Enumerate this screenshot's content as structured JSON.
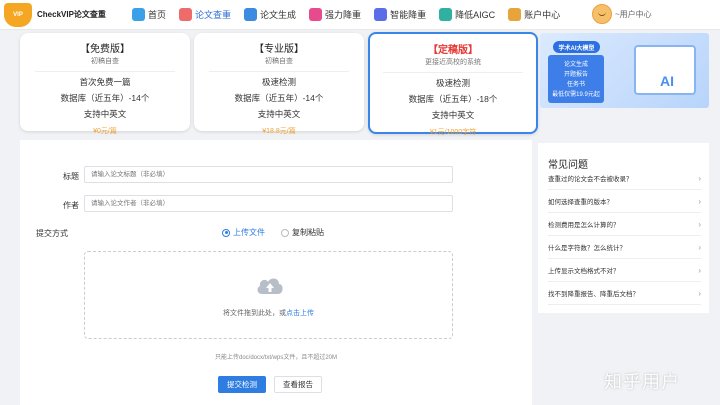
{
  "app": {
    "logo_badge": "VIP",
    "name": "CheckVIP论文查重"
  },
  "nav": [
    {
      "label": "首页",
      "color": "#3aa1e8"
    },
    {
      "label": "论文查重",
      "color": "#ee6b6b",
      "active": true
    },
    {
      "label": "论文生成",
      "color": "#3d8be0"
    },
    {
      "label": "强力降重",
      "color": "#e84a8e"
    },
    {
      "label": "智能降重",
      "color": "#5b6ee8"
    },
    {
      "label": "降低AIGC",
      "color": "#2fb0a0"
    },
    {
      "label": "账户中心",
      "color": "#e8a33a"
    }
  ],
  "user": {
    "label": "~用户中心"
  },
  "plans": [
    {
      "title": "【免费版】",
      "subtitle": "初稿自查",
      "lines": [
        "首次免费一篇",
        "数据库（近五年）-14个",
        "支持中英文"
      ],
      "price": "¥0元/篇"
    },
    {
      "title": "【专业版】",
      "subtitle": "初稿自查",
      "lines": [
        "极速检测",
        "数据库（近五年）-14个",
        "支持中英文"
      ],
      "price": "¥18.8元/篇"
    },
    {
      "title": "【定稿版】",
      "subtitle": "更接近高校的系统",
      "lines": [
        "极速检测",
        "数据库（近五年）-18个",
        "支持中英文"
      ],
      "price": "¥1元/1000字符"
    }
  ],
  "banner": {
    "tag": "学术AI大模型",
    "lines": [
      "论文生成",
      "开题报告",
      "任务书",
      "最低仅需19.9元起"
    ],
    "ai": "AI"
  },
  "form": {
    "title_label": "标题",
    "title_placeholder": "请输入论文标题（非必填）",
    "author_label": "作者",
    "author_placeholder": "请输入论文作者（非必填）",
    "submit_method_label": "提交方式",
    "upload_option": "上传文件",
    "paste_option": "复制粘贴",
    "drop_text": "将文件拖到此处，或",
    "drop_link": "点击上传",
    "hint": "只能上传doc/docx/txt/wps文件，且不超过20M",
    "submit_button": "提交检测",
    "report_button": "查看报告"
  },
  "faq": {
    "title": "常见问题",
    "items": [
      "查重过的论文会不会被收录？",
      "如何选择查重的版本？",
      "检测费用是怎么计算的？",
      "什么是字符数？怎么统计？",
      "上传显示文档格式不对？",
      "找不到降重报告、降重后文档？"
    ]
  },
  "watermark": "知乎用户"
}
